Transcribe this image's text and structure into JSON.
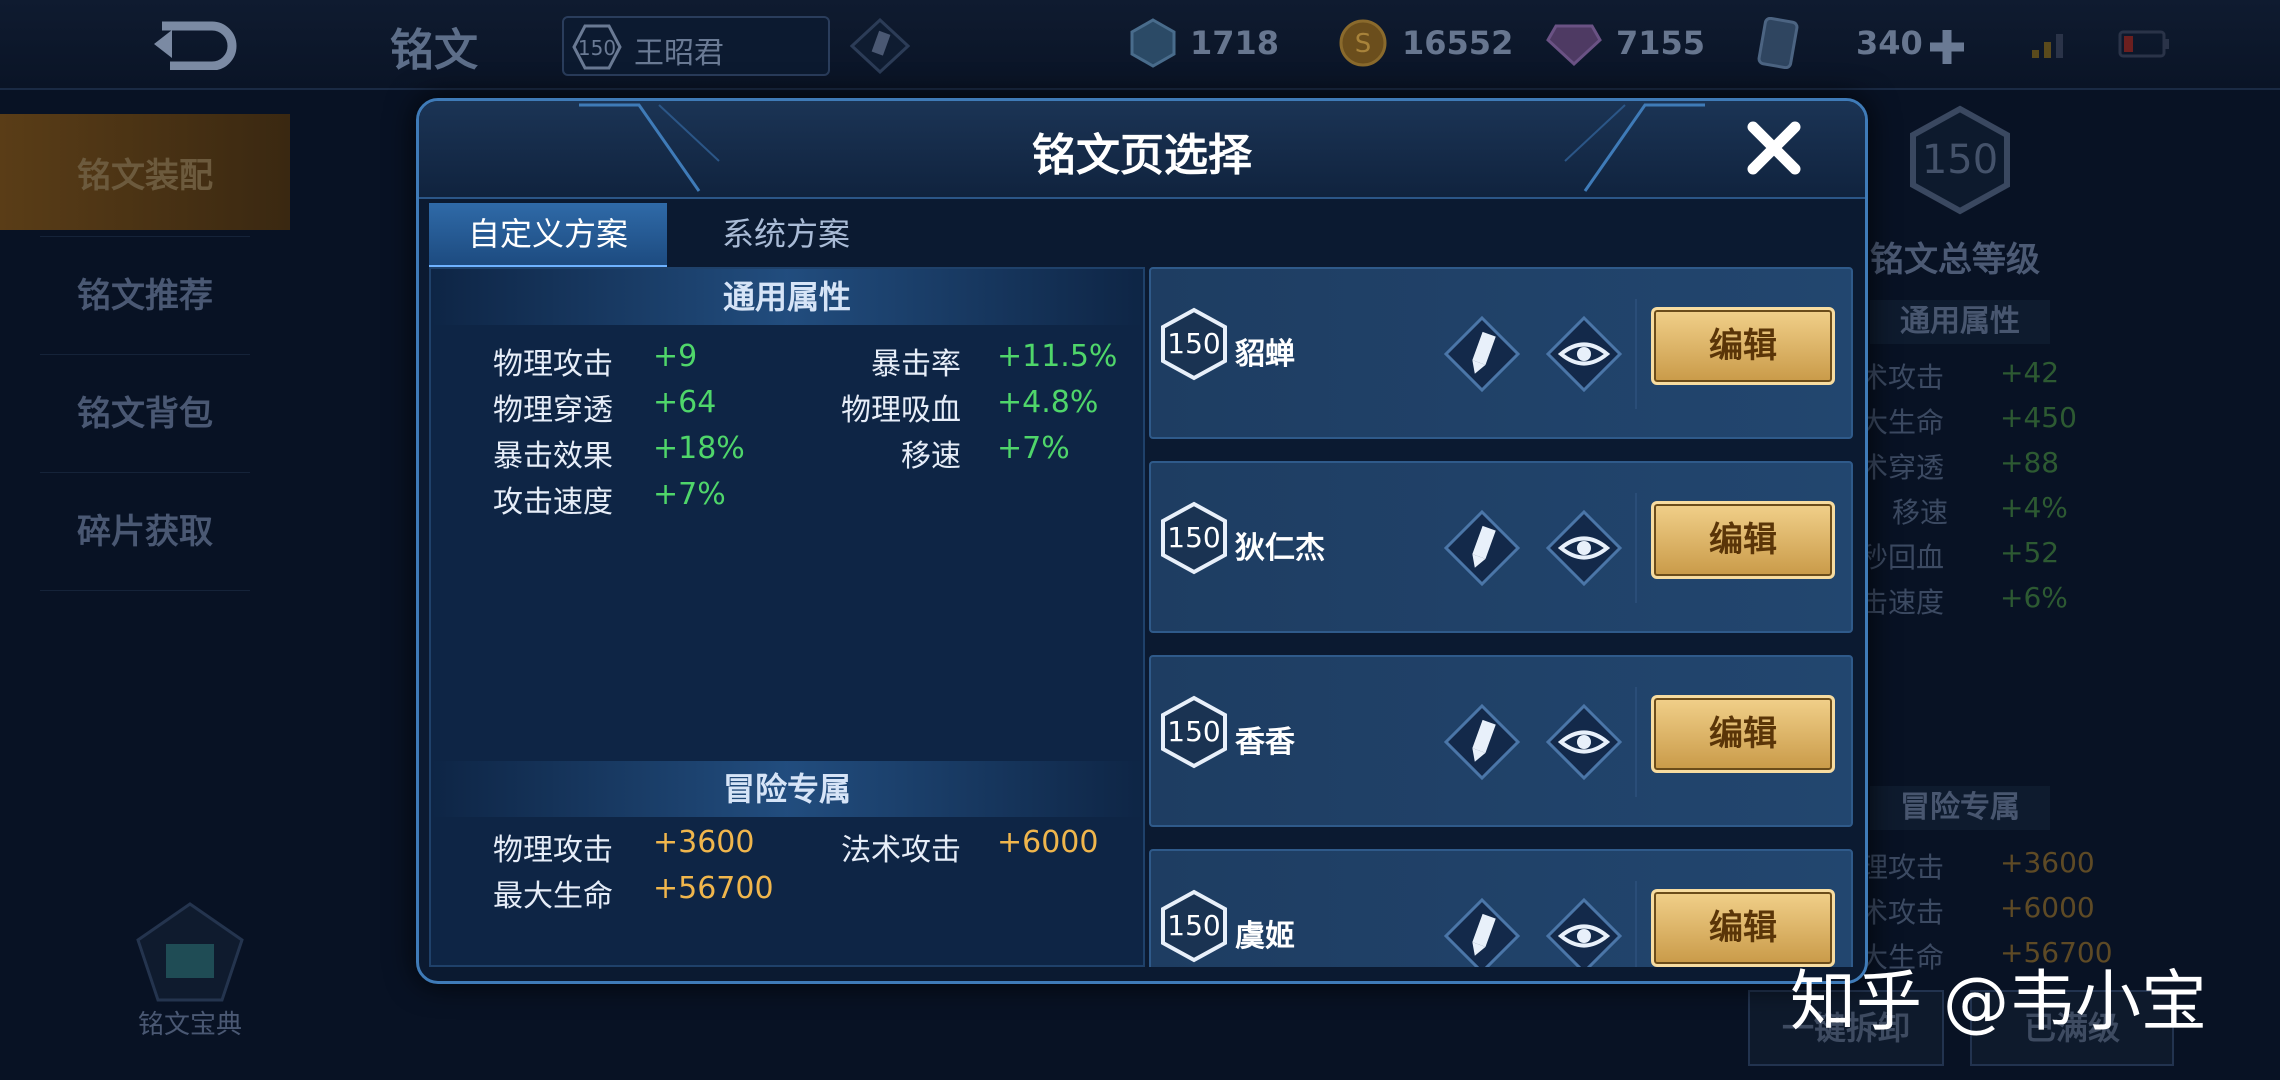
{
  "topbar": {
    "page_title": "铭文",
    "hero_level": "150",
    "hero_name": "王昭君",
    "resources": [
      {
        "icon": "crystal-icon",
        "value": "1718"
      },
      {
        "icon": "gold-coin-icon",
        "value": "16552"
      },
      {
        "icon": "gem-icon",
        "value": "7155"
      },
      {
        "icon": "card-icon",
        "value": "340"
      }
    ]
  },
  "leftnav": {
    "items": [
      "铭文装配",
      "铭文推荐",
      "铭文背包",
      "碎片获取"
    ],
    "active_index": 0,
    "codex_label": "铭文宝典"
  },
  "rightpanel": {
    "total_level": "150",
    "total_level_label": "铭文总等级",
    "general_title": "通用属性",
    "general_rows": [
      {
        "label": "术攻击",
        "value": "+42"
      },
      {
        "label": "大生命",
        "value": "+450"
      },
      {
        "label": "术穿透",
        "value": "+88"
      },
      {
        "label": "移速",
        "value": "+4%"
      },
      {
        "label": "秒回血",
        "value": "+52"
      },
      {
        "label": "击速度",
        "value": "+6%"
      }
    ],
    "adventure_title": "冒险专属",
    "adventure_rows": [
      {
        "label": "理攻击",
        "value": "+3600"
      },
      {
        "label": "术攻击",
        "value": "+6000"
      },
      {
        "label": "大生命",
        "value": "+56700"
      }
    ],
    "dismantle_button": "一键拆卸",
    "maxed_button": "已满级"
  },
  "modal": {
    "title": "铭文页选择",
    "tabs": [
      "自定义方案",
      "系统方案"
    ],
    "active_tab": 0,
    "general_title": "通用属性",
    "general_stats": [
      {
        "label": "物理攻击",
        "value": "+9"
      },
      {
        "label": "暴击率",
        "value": "+11.5%"
      },
      {
        "label": "物理穿透",
        "value": "+64"
      },
      {
        "label": "物理吸血",
        "value": "+4.8%"
      },
      {
        "label": "暴击效果",
        "value": "+18%"
      },
      {
        "label": "移速",
        "value": "+7%"
      },
      {
        "label": "攻击速度",
        "value": "+7%"
      }
    ],
    "adventure_title": "冒险专属",
    "adventure_stats": [
      {
        "label": "物理攻击",
        "value": "+3600"
      },
      {
        "label": "法术攻击",
        "value": "+6000"
      },
      {
        "label": "最大生命",
        "value": "+56700"
      }
    ],
    "pages": [
      {
        "level": "150",
        "name": "貂蝉",
        "edit_label": "编辑"
      },
      {
        "level": "150",
        "name": "狄仁杰",
        "edit_label": "编辑"
      },
      {
        "level": "150",
        "name": "香香",
        "edit_label": "编辑"
      },
      {
        "level": "150",
        "name": "虞姬",
        "edit_label": "编辑"
      }
    ]
  },
  "watermark": "知乎 @韦小宝",
  "colors": {
    "stat_green": "#4fd66a",
    "stat_orange": "#f0b64c",
    "accent_blue": "#3f7bb8",
    "edit_gold": "#d9b066"
  }
}
